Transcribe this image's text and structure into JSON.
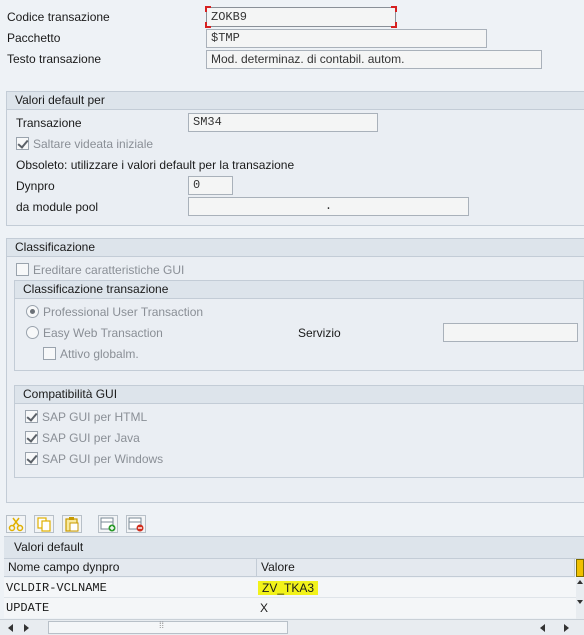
{
  "header": {
    "codice_label": "Codice transazione",
    "codice_value": "ZOKB9",
    "pacchetto_label": "Pacchetto",
    "pacchetto_value": "$TMP",
    "testo_label": "Testo transazione",
    "testo_value": "Mod. determinaz. di contabil. autom."
  },
  "valori_default_per": {
    "title": "Valori default per",
    "transazione_label": "Transazione",
    "transazione_value": "SM34",
    "saltare_label": "Saltare videata iniziale",
    "saltare_checked": true,
    "obsoleto_text": "Obsoleto: utilizzare i valori default per la transazione",
    "dynpro_label": "Dynpro",
    "dynpro_value": "0",
    "module_pool_label": "da module pool",
    "module_pool_value": "."
  },
  "classificazione": {
    "title": "Classificazione",
    "ereditare_label": "Ereditare caratteristiche GUI",
    "ereditare_checked": false,
    "classificazione_transazione": {
      "title": "Classificazione transazione",
      "professional_label": "Professional User Transaction",
      "professional_selected": true,
      "easy_web_label": "Easy Web Transaction",
      "easy_web_selected": false,
      "servizio_label": "Servizio",
      "servizio_value": "",
      "attivo_label": "Attivo globalm.",
      "attivo_checked": false
    },
    "compatibilita_gui": {
      "title": "Compatibilità GUI",
      "html_label": "SAP GUI per HTML",
      "java_label": "SAP GUI per Java",
      "windows_label": "SAP GUI per Windows",
      "html_checked": true,
      "java_checked": true,
      "windows_checked": true
    }
  },
  "table": {
    "title": "Valori default",
    "columns": [
      "Nome campo dynpro",
      "Valore"
    ],
    "rows": [
      {
        "field": "VCLDIR-VCLNAME",
        "value": "ZV_TKA3"
      },
      {
        "field": "UPDATE",
        "value": "X"
      }
    ]
  },
  "scrollbar": {
    "grip": "⁞⁞"
  },
  "colors": {
    "highlight": "#f2f21a",
    "focus_corner": "#d62020"
  }
}
